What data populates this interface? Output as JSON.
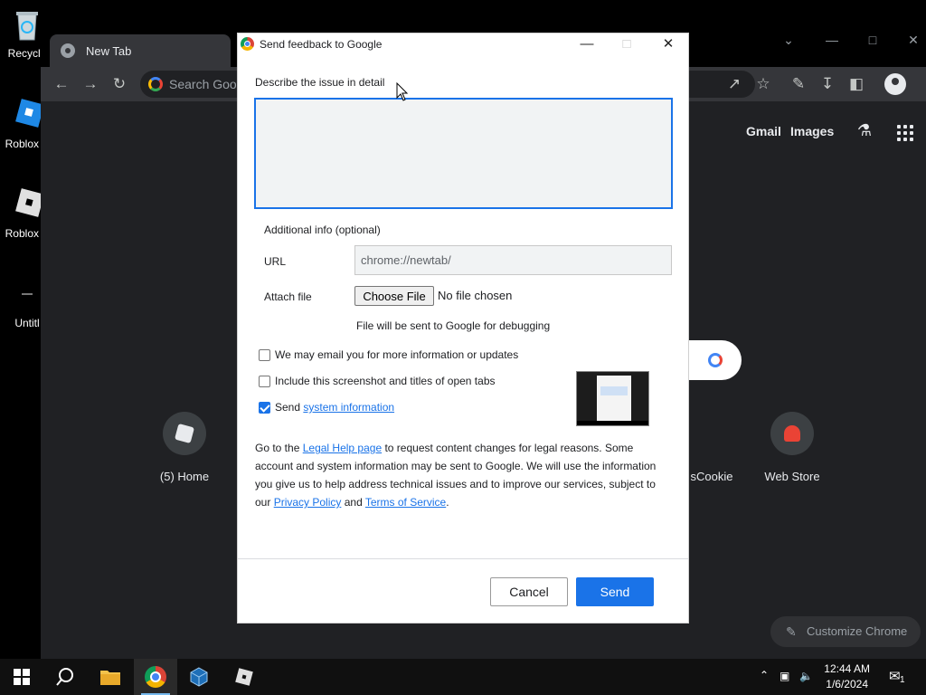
{
  "desktop": {
    "icons": [
      {
        "label": "Recycle"
      },
      {
        "label": "Roblox S"
      },
      {
        "label": "Roblox P"
      },
      {
        "label": "Untitl"
      }
    ]
  },
  "browser": {
    "tab_title": "New Tab",
    "omnibox_placeholder": "Search Goog",
    "ntp": {
      "gmail": "Gmail",
      "images": "Images",
      "shortcuts": [
        {
          "label": "(5) Home"
        },
        {
          "label": "sCookie"
        },
        {
          "label": "Web Store"
        }
      ],
      "customize": "Customize Chrome"
    }
  },
  "dialog": {
    "title": "Send feedback to Google",
    "describe_label": "Describe the issue in detail",
    "describe_value": "",
    "additional_info_label": "Additional info (optional)",
    "url_label": "URL",
    "url_value": "chrome://newtab/",
    "attach_label": "Attach file",
    "choose_file": "Choose File",
    "no_file": "No file chosen",
    "debug_note": "File will be sent to Google for debugging",
    "email_checkbox": {
      "label": "We may email you for more information or updates",
      "checked": false
    },
    "screenshot_checkbox": {
      "label": "Include this screenshot and titles of open tabs",
      "checked": false
    },
    "sysinfo_checkbox": {
      "prefix": "Send",
      "link": "system information",
      "checked": true
    },
    "legal": {
      "p1": "Go to the",
      "legal_link": "Legal Help page",
      "p2": "to request content changes for legal reasons. Some account and system information may be sent to Google. We will use the information you give us to help address technical issues and to improve our services, subject to our",
      "privacy_link": "Privacy Policy",
      "p3": "and",
      "tos_link": "Terms of Service",
      "p4": "."
    },
    "cancel": "Cancel",
    "send": "Send"
  },
  "taskbar": {
    "time": "12:44 AM",
    "date": "1/6/2024",
    "notification_count": "1"
  },
  "colors": {
    "accent": "#1a73e8",
    "chrome_bg": "#202124",
    "toolbar": "#35363a"
  }
}
